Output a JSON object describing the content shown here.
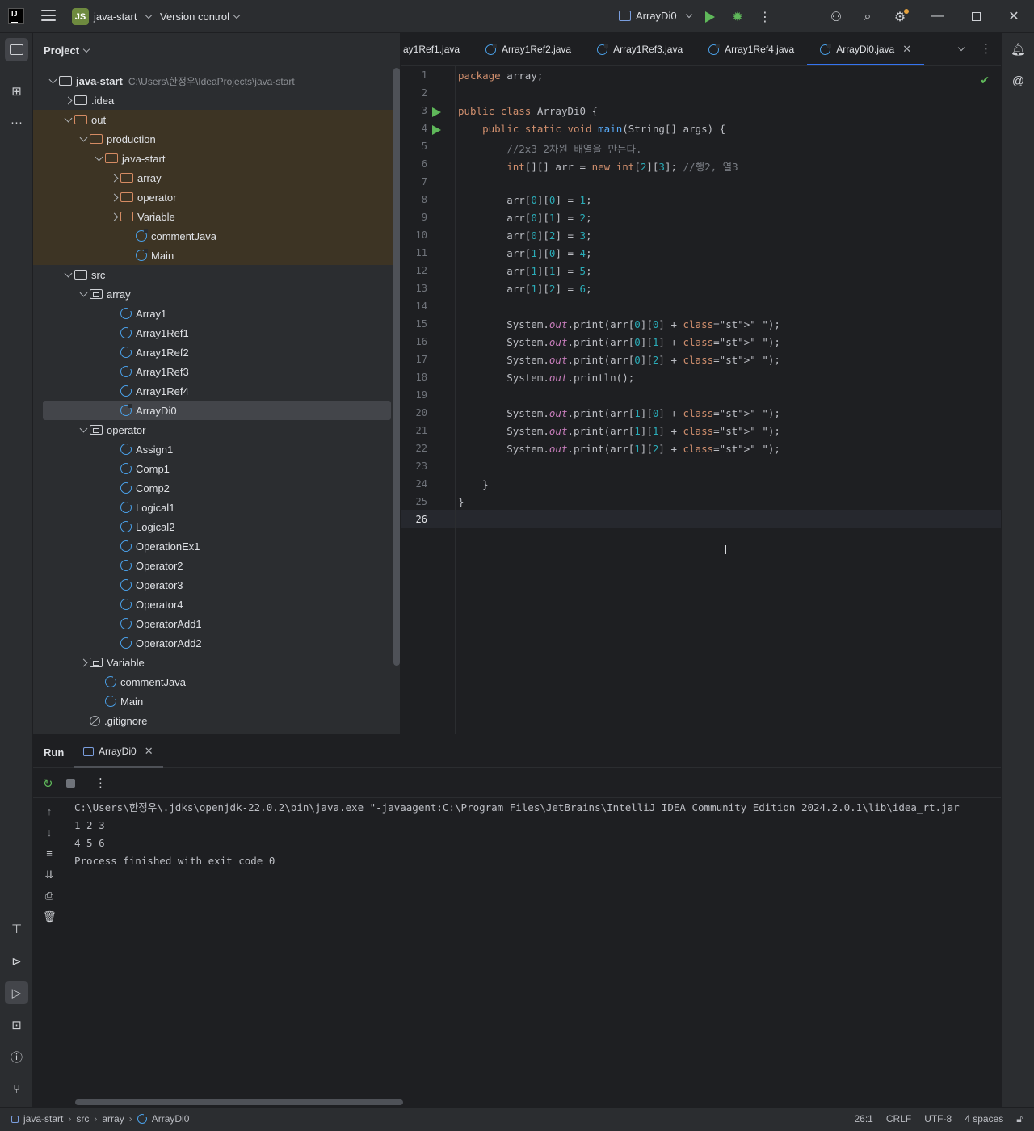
{
  "titlebar": {
    "project_badge": "JS",
    "project_name": "java-start",
    "version_control": "Version control",
    "run_config": "ArrayDi0"
  },
  "project_panel": {
    "title": "Project",
    "tree": [
      {
        "indent": 0,
        "arrow": "down",
        "icon": "folder-module",
        "label": "java-start",
        "path": "C:\\Users\\한정우\\IdeaProjects\\java-start",
        "bold": true
      },
      {
        "indent": 1,
        "arrow": "right",
        "icon": "folder",
        "label": ".idea"
      },
      {
        "indent": 1,
        "arrow": "down",
        "icon": "folder-orange",
        "label": "out",
        "excluded": true
      },
      {
        "indent": 2,
        "arrow": "down",
        "icon": "folder-orange",
        "label": "production",
        "excluded": true
      },
      {
        "indent": 3,
        "arrow": "down",
        "icon": "folder-orange",
        "label": "java-start",
        "excluded": true
      },
      {
        "indent": 4,
        "arrow": "right",
        "icon": "folder-orange",
        "label": "array",
        "excluded": true
      },
      {
        "indent": 4,
        "arrow": "right",
        "icon": "folder-orange",
        "label": "operator",
        "excluded": true
      },
      {
        "indent": 4,
        "arrow": "right",
        "icon": "folder-orange",
        "label": "Variable",
        "excluded": true
      },
      {
        "indent": 5,
        "arrow": "none",
        "icon": "class",
        "label": "commentJava",
        "excluded": true
      },
      {
        "indent": 5,
        "arrow": "none",
        "icon": "class",
        "label": "Main",
        "excluded": true
      },
      {
        "indent": 1,
        "arrow": "down",
        "icon": "folder",
        "label": "src"
      },
      {
        "indent": 2,
        "arrow": "down",
        "icon": "package",
        "label": "array"
      },
      {
        "indent": 4,
        "arrow": "none",
        "icon": "class",
        "label": "Array1"
      },
      {
        "indent": 4,
        "arrow": "none",
        "icon": "class",
        "label": "Array1Ref1"
      },
      {
        "indent": 4,
        "arrow": "none",
        "icon": "class",
        "label": "Array1Ref2"
      },
      {
        "indent": 4,
        "arrow": "none",
        "icon": "class",
        "label": "Array1Ref3"
      },
      {
        "indent": 4,
        "arrow": "none",
        "icon": "class",
        "label": "Array1Ref4"
      },
      {
        "indent": 4,
        "arrow": "none",
        "icon": "class",
        "label": "ArrayDi0",
        "selected": true
      },
      {
        "indent": 2,
        "arrow": "down",
        "icon": "package",
        "label": "operator"
      },
      {
        "indent": 4,
        "arrow": "none",
        "icon": "class",
        "label": "Assign1"
      },
      {
        "indent": 4,
        "arrow": "none",
        "icon": "class",
        "label": "Comp1"
      },
      {
        "indent": 4,
        "arrow": "none",
        "icon": "class",
        "label": "Comp2"
      },
      {
        "indent": 4,
        "arrow": "none",
        "icon": "class",
        "label": "Logical1"
      },
      {
        "indent": 4,
        "arrow": "none",
        "icon": "class",
        "label": "Logical2"
      },
      {
        "indent": 4,
        "arrow": "none",
        "icon": "class",
        "label": "OperationEx1"
      },
      {
        "indent": 4,
        "arrow": "none",
        "icon": "class",
        "label": "Operator2"
      },
      {
        "indent": 4,
        "arrow": "none",
        "icon": "class",
        "label": "Operator3"
      },
      {
        "indent": 4,
        "arrow": "none",
        "icon": "class",
        "label": "Operator4"
      },
      {
        "indent": 4,
        "arrow": "none",
        "icon": "class",
        "label": "OperatorAdd1"
      },
      {
        "indent": 4,
        "arrow": "none",
        "icon": "class",
        "label": "OperatorAdd2"
      },
      {
        "indent": 2,
        "arrow": "right",
        "icon": "package",
        "label": "Variable"
      },
      {
        "indent": 3,
        "arrow": "none",
        "icon": "class",
        "label": "commentJava"
      },
      {
        "indent": 3,
        "arrow": "none",
        "icon": "class",
        "label": "Main"
      },
      {
        "indent": 2,
        "arrow": "none",
        "icon": "ignore",
        "label": ".gitignore"
      }
    ]
  },
  "editor": {
    "tabs": [
      {
        "label": "ay1Ref1.java",
        "active": false,
        "icon": false
      },
      {
        "label": "Array1Ref2.java",
        "active": false,
        "icon": true
      },
      {
        "label": "Array1Ref3.java",
        "active": false,
        "icon": true
      },
      {
        "label": "Array1Ref4.java",
        "active": false,
        "icon": true
      },
      {
        "label": "ArrayDi0.java",
        "active": true,
        "icon": true
      }
    ],
    "current_line": 26,
    "run_gutter_lines": [
      3,
      4
    ],
    "lines": [
      "package array;",
      "",
      "public class ArrayDi0 {",
      "    public static void main(String[] args) {",
      "        //2x3 2차원 배열을 만든다.",
      "        int[][] arr = new int[2][3]; //행2, 열3",
      "",
      "        arr[0][0] = 1;",
      "        arr[0][1] = 2;",
      "        arr[0][2] = 3;",
      "        arr[1][0] = 4;",
      "        arr[1][1] = 5;",
      "        arr[1][2] = 6;",
      "",
      "        System.out.print(arr[0][0] + \" \");",
      "        System.out.print(arr[0][1] + \" \");",
      "        System.out.print(arr[0][2] + \" \");",
      "        System.out.println();",
      "",
      "        System.out.print(arr[1][0] + \" \");",
      "        System.out.print(arr[1][1] + \" \");",
      "        System.out.print(arr[1][2] + \" \");",
      "",
      "    }",
      "}",
      ""
    ]
  },
  "run_panel": {
    "title": "Run",
    "tab_label": "ArrayDi0",
    "output": [
      "C:\\Users\\한정우\\.jdks\\openjdk-22.0.2\\bin\\java.exe \"-javaagent:C:\\Program Files\\JetBrains\\IntelliJ IDEA Community Edition 2024.2.0.1\\lib\\idea_rt.jar",
      "1 2 3",
      "4 5 6",
      "Process finished with exit code 0"
    ]
  },
  "statusbar": {
    "breadcrumbs": [
      "java-start",
      "src",
      "array",
      "ArrayDi0"
    ],
    "position": "26:1",
    "line_ending": "CRLF",
    "encoding": "UTF-8",
    "indent": "4 spaces"
  }
}
